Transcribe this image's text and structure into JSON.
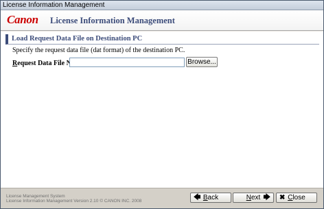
{
  "window": {
    "title": "License Information Management"
  },
  "header": {
    "logo": "Canon",
    "title": "License Information Management"
  },
  "section": {
    "title": "Load Request Data File on Destination PC",
    "description": "Specify the request data file (dat format) of the destination PC."
  },
  "form": {
    "label_first": "R",
    "label_rest": "equest Data File Name:",
    "value": "",
    "browse_label": "Browse..."
  },
  "footer": {
    "line1": "License Management System",
    "line2": "License Information Management Version 2.10 © CANON INC. 2008"
  },
  "buttons": {
    "back_first": "B",
    "back_rest": "ack",
    "next_first": "N",
    "next_rest": "ext",
    "close_first": "C",
    "close_rest": "lose",
    "back_icon": "arrow-left-icon",
    "next_icon": "arrow-right-icon",
    "close_icon": "close-x-icon"
  },
  "colors": {
    "brand_red": "#cc0000",
    "heading_blue": "#3c4c7a"
  }
}
